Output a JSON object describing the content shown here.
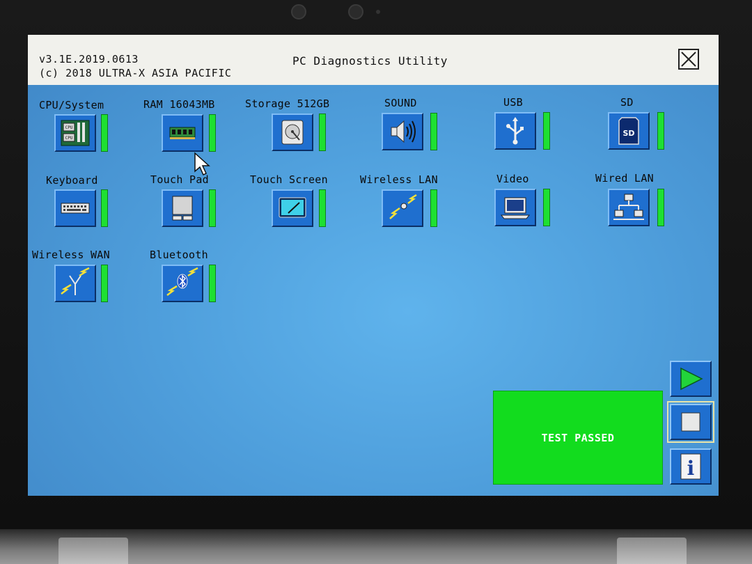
{
  "window": {
    "version": "v3.1E.2019.0613",
    "copyright": "(c) 2018 ULTRA-X ASIA PACIFIC",
    "title": "PC Diagnostics Utility",
    "close_icon": "close-x-icon"
  },
  "devices": [
    {
      "label": "CPU/System",
      "icon": "cpu-system-icon",
      "status": "passed"
    },
    {
      "label": "RAM 16043MB",
      "icon": "ram-module-icon",
      "status": "passed"
    },
    {
      "label": "Storage 512GB",
      "icon": "storage-drive-icon",
      "status": "passed"
    },
    {
      "label": "SOUND",
      "icon": "speaker-icon",
      "status": "passed"
    },
    {
      "label": "USB",
      "icon": "usb-icon",
      "status": "passed"
    },
    {
      "label": "SD",
      "icon": "sd-card-icon",
      "status": "passed"
    },
    {
      "label": "Keyboard",
      "icon": "keyboard-icon",
      "status": "passed"
    },
    {
      "label": "Touch Pad",
      "icon": "touchpad-icon",
      "status": "passed"
    },
    {
      "label": "Touch Screen",
      "icon": "touchscreen-icon",
      "status": "passed"
    },
    {
      "label": "Wireless LAN",
      "icon": "wireless-lan-icon",
      "status": "passed"
    },
    {
      "label": "Video",
      "icon": "monitor-icon",
      "status": "passed"
    },
    {
      "label": "Wired LAN",
      "icon": "wired-network-icon",
      "status": "passed"
    },
    {
      "label": "Wireless WAN",
      "icon": "antenna-icon",
      "status": "passed"
    },
    {
      "label": "Bluetooth",
      "icon": "bluetooth-icon",
      "status": "passed"
    }
  ],
  "result": {
    "text": "TEST PASSED",
    "color": "#12dc1e"
  },
  "controls": {
    "play_icon": "play-icon",
    "stop_icon": "stop-icon",
    "info_icon": "info-icon",
    "info_glyph": "i"
  },
  "colors": {
    "screen_bg": "#4f9fdc",
    "tile_blue": "#1f6fcf",
    "status_green": "#1ee032",
    "titlebar_bg": "#f1f1ec"
  }
}
